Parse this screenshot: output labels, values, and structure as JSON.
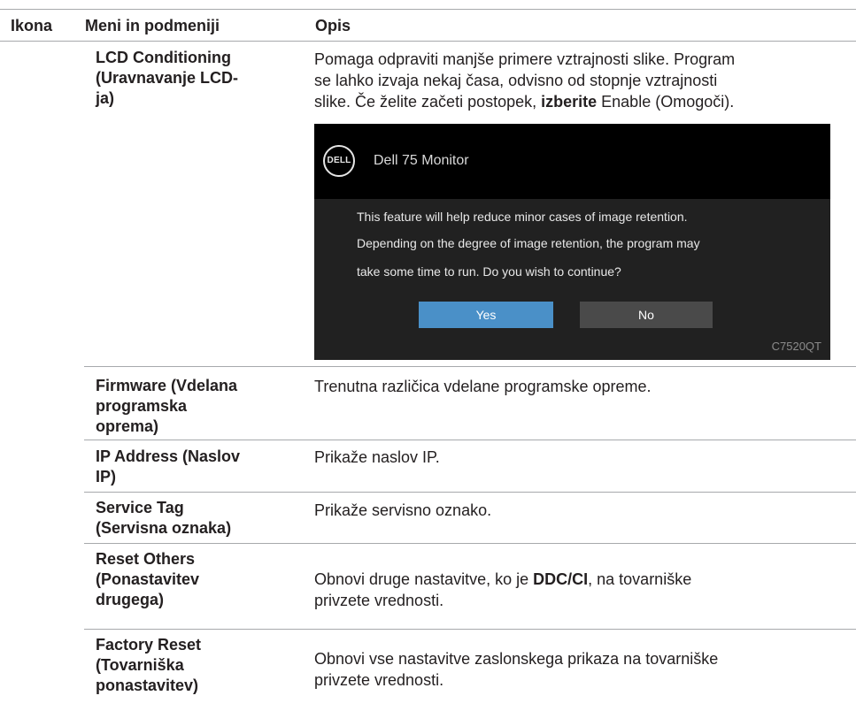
{
  "table": {
    "headers": {
      "icon": "Ikona",
      "menu": "Meni in podmeniji",
      "description": "Opis"
    }
  },
  "rows": [
    {
      "menu": "LCD Conditioning (Uravnavanje LCD-ja)",
      "menu_lines": [
        "LCD Conditioning",
        "(Uravnavanje LCD-",
        "ja)"
      ],
      "description_lines": [
        "Pomaga odpraviti manjše primere vztrajnosti slike. Program",
        "se lahko izvaja nekaj časa, odvisno od stopnje vztrajnosti"
      ],
      "description_line3_prefix": "slike. Če želite začeti postopek, ",
      "description_bold": "izberite",
      "description_line3_suffix": " Enable (Omogoči)."
    },
    {
      "menu_lines": [
        "Firmware (Vdelana",
        "programska",
        "oprema)"
      ],
      "description": "Trenutna različica vdelane programske opreme."
    },
    {
      "menu_lines": [
        "IP Address (Naslov",
        "IP)"
      ],
      "description": "Prikaže naslov IP."
    },
    {
      "menu_lines": [
        "Service Tag",
        "(Servisna oznaka)"
      ],
      "description": "Prikaže servisno oznako."
    },
    {
      "menu_lines": [
        "Reset Others",
        "(Ponastavitev",
        "drugega)"
      ],
      "description_prefix": "Obnovi druge nastavitve, ko je ",
      "description_bold": "DDC/CI",
      "description_suffix": ", na tovarniške",
      "description_line2": "privzete vrednosti."
    },
    {
      "menu_lines": [
        "Factory Reset",
        "(Tovarniška",
        "ponastavitev)"
      ],
      "description_lines": [
        "Obnovi vse nastavitve zaslonskega prikaza na tovarniške",
        "privzete vrednosti."
      ]
    }
  ],
  "osd": {
    "logo_text": "DELL",
    "title": "Dell 75 Monitor",
    "message_lines": [
      "This feature will help reduce minor cases of image retention.",
      "Depending on the degree of image retention, the program may",
      "take some time to run. Do you wish to continue?"
    ],
    "yes_label": "Yes",
    "no_label": "No",
    "model": "C7520QT",
    "colors": {
      "yes": "#4a90c8",
      "no": "#4a4a4a",
      "header": "#000000",
      "body": "#212121"
    }
  }
}
